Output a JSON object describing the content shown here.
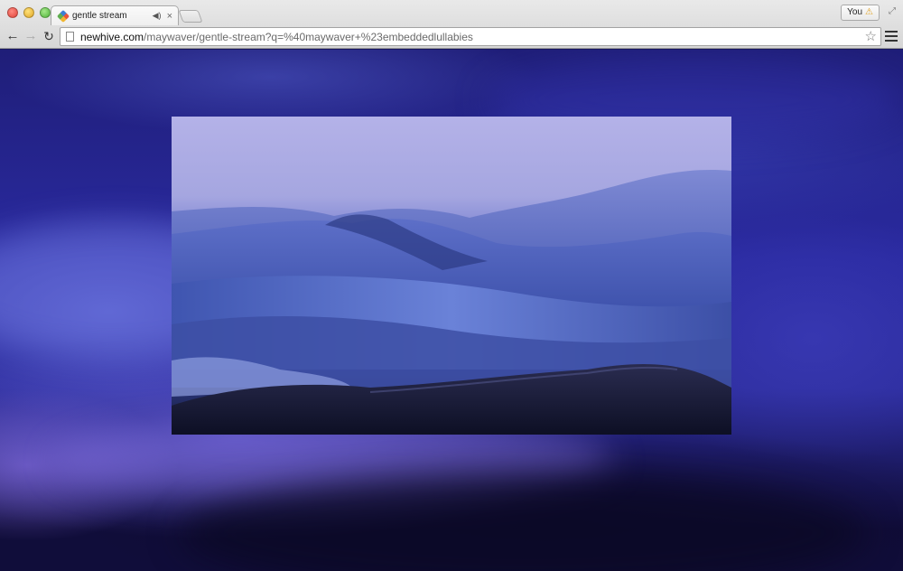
{
  "browser": {
    "tab_title": "gentle stream",
    "tab_audio_icon": "speaker-icon",
    "tab_close_glyph": "×",
    "profile_label": "You",
    "profile_warning_glyph": "⚠",
    "url_host": "newhive.com",
    "url_path": "/maywaver/gentle-stream?q=%40maywaver+%23embeddedlullabies"
  },
  "icons": {
    "back": "←",
    "forward": "→",
    "reload": "↻",
    "star": "☆",
    "fullscreen": "⤢",
    "audio": "◀)"
  },
  "colors": {
    "page_bg": "#2a2aa0",
    "video_sky": "#b4b2e8",
    "fabric": "#4660b8"
  }
}
